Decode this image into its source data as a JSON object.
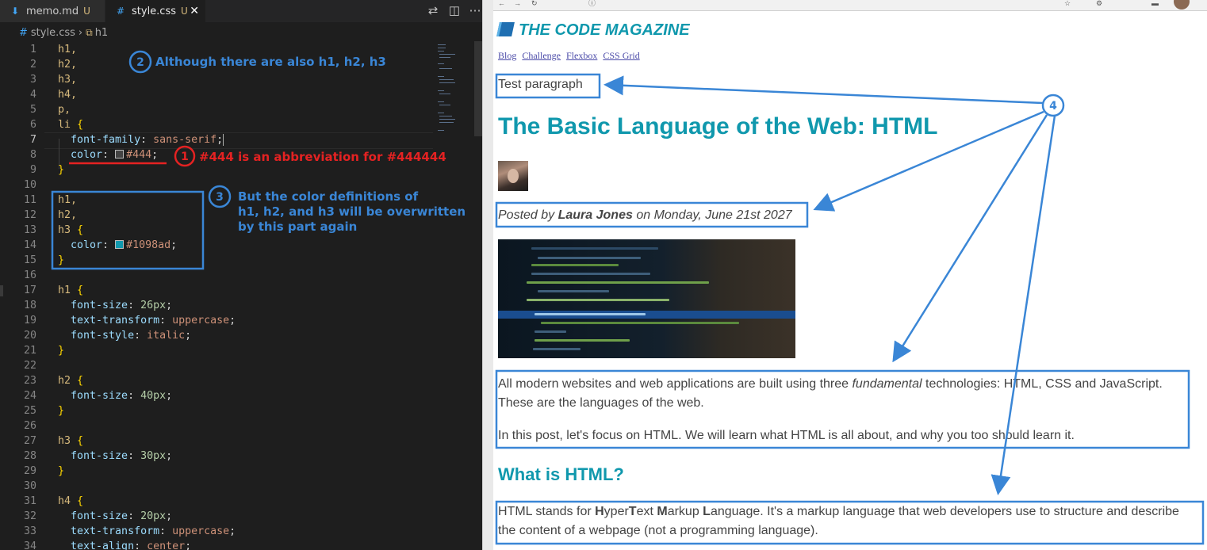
{
  "editor": {
    "tabs": [
      {
        "icon": "markdown-icon",
        "label": "memo.md",
        "status": "U"
      },
      {
        "icon": "hash-icon",
        "label": "style.css",
        "status": "U"
      }
    ],
    "breadcrumb": {
      "file": "style.css",
      "symbol": "h1"
    },
    "line_numbers": [
      "1",
      "2",
      "3",
      "4",
      "5",
      "6",
      "7",
      "8",
      "9",
      "10",
      "11",
      "12",
      "13",
      "14",
      "15",
      "16",
      "17",
      "18",
      "19",
      "20",
      "21",
      "22",
      "23",
      "24",
      "25",
      "26",
      "27",
      "28",
      "29",
      "30",
      "31",
      "32",
      "33",
      "34"
    ],
    "code": {
      "l1": "h1,",
      "l2": "h2,",
      "l3": "h3,",
      "l4": "h4,",
      "l5": "p,",
      "l6_sel": "li",
      "l6_brace": "{",
      "l7_prop": "font-family",
      "l7_val": "sans-serif",
      "l8_prop": "color",
      "l8_val": "#444",
      "l9_brace": "}",
      "l11": "h1,",
      "l12": "h2,",
      "l13_sel": "h3",
      "l13_brace": "{",
      "l14_prop": "color",
      "l14_val": "#1098ad",
      "l15_brace": "}",
      "l17_sel": "h1",
      "l17_brace": "{",
      "l18_prop": "font-size",
      "l18_val": "26px",
      "l19_prop": "text-transform",
      "l19_val": "uppercase",
      "l20_prop": "font-style",
      "l20_val": "italic",
      "l21_brace": "}",
      "l23_sel": "h2",
      "l23_brace": "{",
      "l24_prop": "font-size",
      "l24_val": "40px",
      "l25_brace": "}",
      "l27_sel": "h3",
      "l27_brace": "{",
      "l28_prop": "font-size",
      "l28_val": "30px",
      "l29_brace": "}",
      "l31_sel": "h4",
      "l31_brace": "{",
      "l32_prop": "font-size",
      "l32_val": "20px",
      "l33_prop": "text-transform",
      "l33_val": "uppercase",
      "l34_prop": "text-align",
      "l34_val": "center"
    },
    "swatch_colors": {
      "gray": "#444444",
      "teal": "#1098ad"
    }
  },
  "browser": {
    "site_title": "THE CODE MAGAZINE",
    "nav_links": [
      "Blog",
      "Challenge",
      "Flexbox",
      "CSS Grid"
    ],
    "test_paragraph": "Test paragraph",
    "post_title": "The Basic Language of the Web: HTML",
    "meta": {
      "prefix": "Posted by ",
      "author": "Laura Jones",
      "suffix": " on Monday, June 21st 2027"
    },
    "p1": {
      "a": "All modern websites and web applications are built using three ",
      "em": "fundamental",
      "b": " technologies: HTML, CSS and JavaScript."
    },
    "p1b": "These are the languages of the web.",
    "p2": "In this post, let's focus on HTML. We will learn what HTML is all about, and why you too should learn it.",
    "h2": "What is HTML?",
    "p3": {
      "s1": "HTML stands for ",
      "H": "H",
      "s2": "yper",
      "T": "T",
      "s3": "ext ",
      "M": "M",
      "s4": "arkup ",
      "L": "L",
      "s5": "anguage. It's a markup language that web developers use to structure and describe"
    },
    "p3b": "the content of a webpage (not a programming language).",
    "accent_color": "#1098ad",
    "text_color": "#444444"
  },
  "annotations": {
    "n1": "1",
    "t1": "#444 is an abbreviation for #444444",
    "n2": "2",
    "t2": "Although there are also h1, h2, h3",
    "n3": "3",
    "t3a": "But the color definitions of",
    "t3b": "h1, h2, and h3 will be overwritten",
    "t3c": "by this part again",
    "n4": "4",
    "blue": "#3a86d6",
    "red": "#e52222"
  }
}
